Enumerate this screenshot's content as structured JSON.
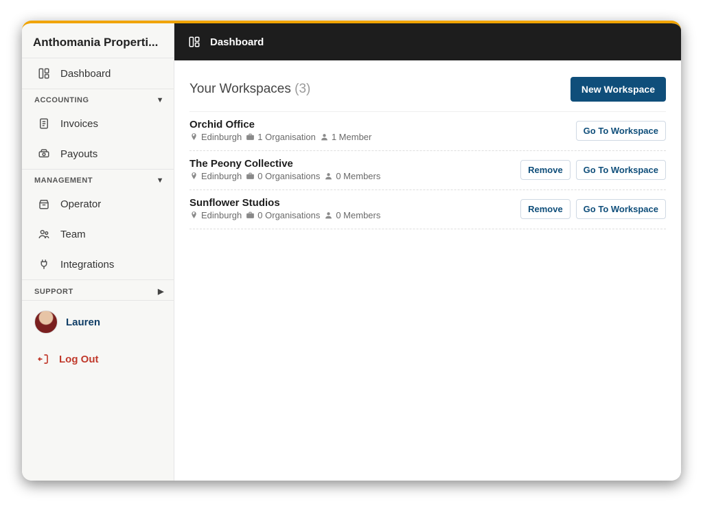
{
  "org_name": "Anthomania Properti...",
  "sidebar": {
    "dashboard_label": "Dashboard",
    "sections": {
      "accounting": {
        "label": "ACCOUNTING",
        "items": {
          "invoices": "Invoices",
          "payouts": "Payouts"
        }
      },
      "management": {
        "label": "MANAGEMENT",
        "items": {
          "operator": "Operator",
          "team": "Team",
          "integrations": "Integrations"
        }
      },
      "support": {
        "label": "SUPPORT"
      }
    },
    "user_name": "Lauren",
    "logout_label": "Log Out"
  },
  "header": {
    "title": "Dashboard"
  },
  "workspaces": {
    "title": "Your Workspaces",
    "count": "(3)",
    "new_button": "New Workspace",
    "goto_label": "Go To Workspace",
    "remove_label": "Remove",
    "items": [
      {
        "name": "Orchid Office",
        "location": "Edinburgh",
        "orgs": "1 Organisation",
        "members": "1 Member",
        "has_remove": false
      },
      {
        "name": "The Peony Collective",
        "location": "Edinburgh",
        "orgs": "0 Organisations",
        "members": "0 Members",
        "has_remove": true
      },
      {
        "name": "Sunflower Studios",
        "location": "Edinburgh",
        "orgs": "0 Organisations",
        "members": "0 Members",
        "has_remove": true
      }
    ]
  }
}
